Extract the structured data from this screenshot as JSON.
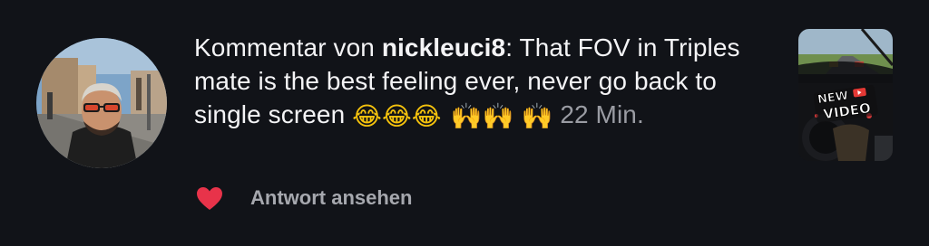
{
  "notification": {
    "prefix": "Kommentar von ",
    "username": "nickleuci8",
    "separator": ": ",
    "comment": "That FOV in Triples mate is the best feeling ever, never go back to single screen",
    "emojis": {
      "joy": "😂😂😂",
      "hands_line1": "🙌🙌",
      "hands_line2": "🙌"
    },
    "timestamp": "22 Min.",
    "reply_label": "Antwort ansehen",
    "liked": true,
    "like_color": "#e8334a"
  },
  "thumbnail": {
    "badge_top": "NEW",
    "badge_bottom": "VIDEO"
  }
}
